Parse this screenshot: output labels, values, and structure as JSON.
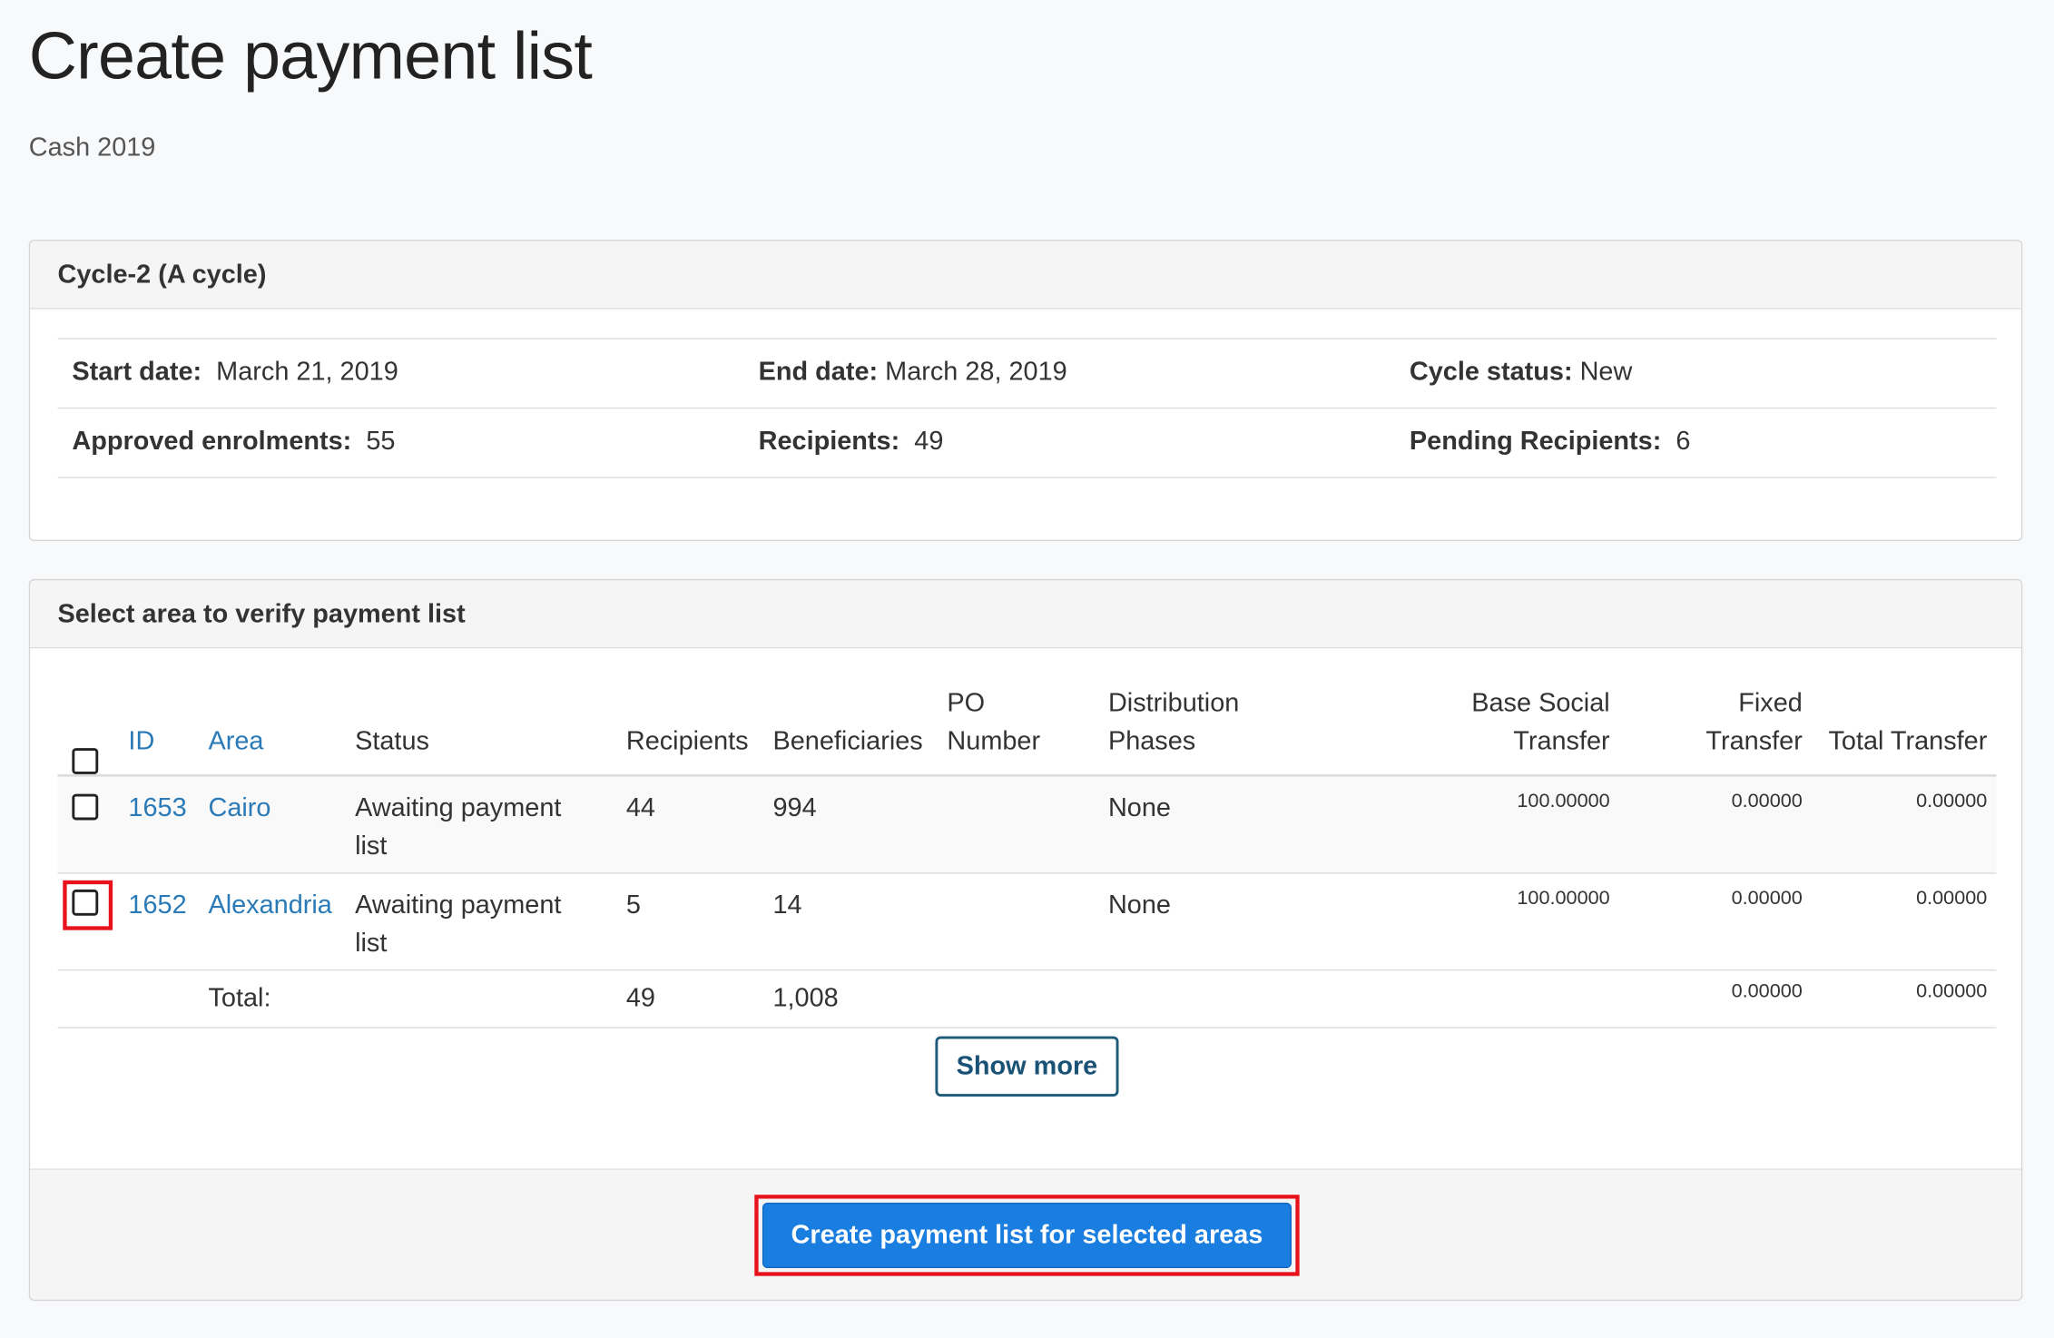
{
  "page": {
    "title": "Create payment list",
    "subtitle": "Cash 2019"
  },
  "cycle": {
    "heading": "Cycle-2 (A cycle)",
    "start_date_label": "Start date:",
    "start_date": "March 21, 2019",
    "end_date_label": "End date:",
    "end_date": "March 28, 2019",
    "status_label": "Cycle status:",
    "status": "New",
    "approved_label": "Approved enrolments:",
    "approved": "55",
    "recipients_label": "Recipients:",
    "recipients": "49",
    "pending_label": "Pending Recipients:",
    "pending": "6"
  },
  "areas": {
    "heading": "Select area to verify payment list",
    "columns": {
      "id": "ID",
      "area": "Area",
      "status": "Status",
      "recipients": "Recipients",
      "beneficiaries": "Beneficiaries",
      "po_line1": "PO",
      "po_line2": "Number",
      "dist_line1": "Distribution",
      "dist_line2": "Phases",
      "base_line1": "Base Social",
      "base_line2": "Transfer",
      "fixed_line1": "Fixed",
      "fixed_line2": "Transfer",
      "total": "Total Transfer"
    },
    "rows": [
      {
        "id": "1653",
        "area": "Cairo",
        "status_line1": "Awaiting payment",
        "status_line2": "list",
        "recipients": "44",
        "beneficiaries": "994",
        "po_number": "",
        "phases": "None",
        "base_transfer": "100.00000",
        "fixed_transfer": "0.00000",
        "total_transfer": "0.00000",
        "checked": false
      },
      {
        "id": "1652",
        "area": "Alexandria",
        "status_line1": "Awaiting payment",
        "status_line2": "list",
        "recipients": "5",
        "beneficiaries": "14",
        "po_number": "",
        "phases": "None",
        "base_transfer": "100.00000",
        "fixed_transfer": "0.00000",
        "total_transfer": "0.00000",
        "checked": false
      }
    ],
    "totals": {
      "label": "Total:",
      "recipients": "49",
      "beneficiaries": "1,008",
      "fixed_transfer": "0.00000",
      "total_transfer": "0.00000"
    },
    "show_more_label": "Show more",
    "create_button_label": "Create payment list for selected areas"
  },
  "colors": {
    "link": "#2a7ab8",
    "primary": "#1a7de0",
    "highlight": "#e8121d"
  }
}
